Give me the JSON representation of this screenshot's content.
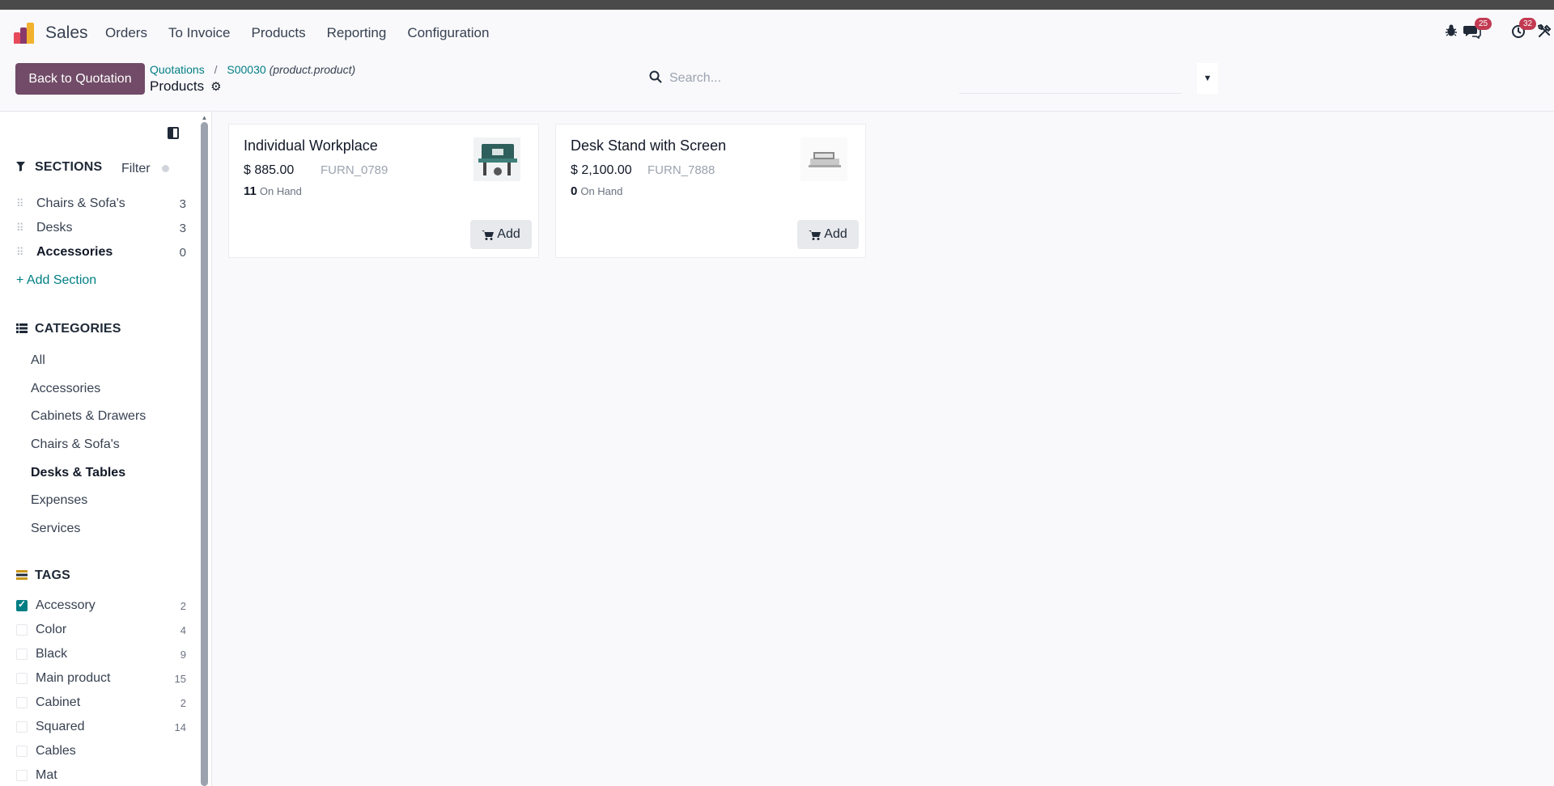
{
  "app": {
    "name": "Sales",
    "menu": [
      "Orders",
      "To Invoice",
      "Products",
      "Reporting",
      "Configuration"
    ],
    "brand_colors": [
      "#e64a5b",
      "#f3b22e",
      "#8a3a6a"
    ]
  },
  "systray": {
    "bug_icon": "bug-icon",
    "messages_count": "25",
    "activities_count": "32",
    "tools_icon": "tools-icon"
  },
  "control_panel": {
    "back_button": "Back to Quotation",
    "breadcrumb": {
      "root": "Quotations",
      "separator": "/",
      "record": "S00030",
      "record_model": "(product.product)"
    },
    "title": "Products",
    "search_placeholder": "Search..."
  },
  "sidebar": {
    "sections": {
      "heading": "SECTIONS",
      "filter_label": "Filter",
      "items": [
        {
          "label": "Chairs & Sofa's",
          "count": "3"
        },
        {
          "label": "Desks",
          "count": "3"
        },
        {
          "label": "Accessories",
          "count": "0"
        }
      ],
      "add_label": "+ Add Section"
    },
    "categories": {
      "heading": "CATEGORIES",
      "items": [
        "All",
        "Accessories",
        "Cabinets & Drawers",
        "Chairs & Sofa's",
        "Desks & Tables",
        "Expenses",
        "Services"
      ],
      "active": "Desks & Tables"
    },
    "tags": {
      "heading": "TAGS",
      "items": [
        {
          "label": "Accessory",
          "count": "2",
          "checked": true
        },
        {
          "label": "Color",
          "count": "4",
          "checked": false
        },
        {
          "label": "Black",
          "count": "9",
          "checked": false
        },
        {
          "label": "Main product",
          "count": "15",
          "checked": false
        },
        {
          "label": "Cabinet",
          "count": "2",
          "checked": false
        },
        {
          "label": "Squared",
          "count": "14",
          "checked": false
        },
        {
          "label": "Cables",
          "count": "",
          "checked": false
        },
        {
          "label": "Mat",
          "count": "",
          "checked": false
        }
      ]
    }
  },
  "products": [
    {
      "name": "Individual Workplace",
      "price": "$ 885.00",
      "ref": "FURN_0789",
      "qty": "11",
      "qty_label": "On Hand",
      "add_label": "Add"
    },
    {
      "name": "Desk Stand with Screen",
      "price": "$ 2,100.00",
      "ref": "FURN_7888",
      "qty": "0",
      "qty_label": "On Hand",
      "add_label": "Add"
    }
  ]
}
